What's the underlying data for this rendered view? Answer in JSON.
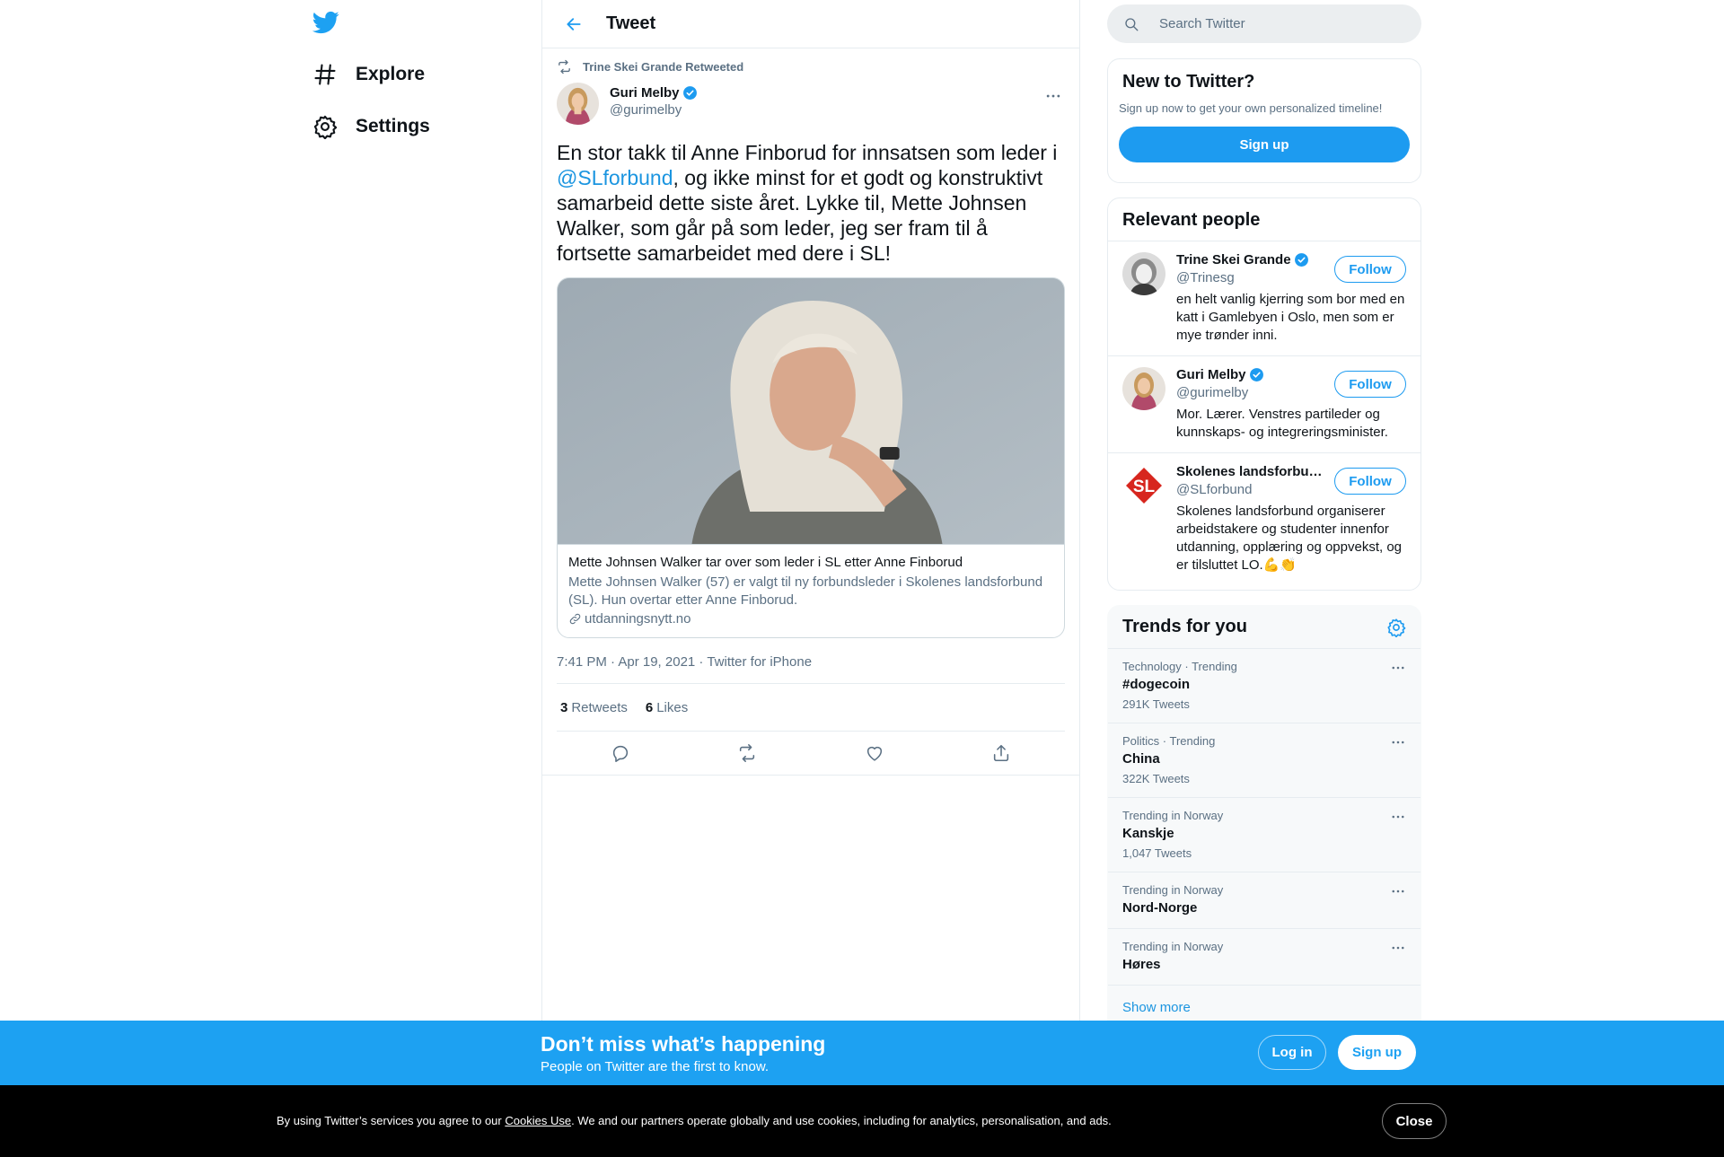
{
  "nav": {
    "logo_icon": "twitter-bird-icon",
    "items": [
      {
        "label": "Explore",
        "icon": "hashtag-icon"
      },
      {
        "label": "Settings",
        "icon": "gear-icon"
      }
    ]
  },
  "header": {
    "title": "Tweet",
    "back_icon": "back-arrow-icon"
  },
  "tweet": {
    "retweeted_by": "Trine Skei Grande Retweeted",
    "author_name": "Guri Melby",
    "author_handle": "@gurimelby",
    "text_before": "En stor takk til Anne Finborud for innsatsen som leder i ",
    "mention": "@SLforbund",
    "text_after": ", og ikke minst for et godt og konstruktivt samarbeid dette siste året. Lykke til, Mette Johnsen Walker, som går på som leder, jeg ser fram til å fortsette samarbeidet med dere i SL!",
    "card": {
      "title": "Mette Johnsen Walker tar over som leder i SL etter Anne Finborud",
      "description": "Mette Johnsen Walker (57) er valgt til ny forbundsleder i Skolenes landsforbund (SL). Hun overtar etter Anne Finborud.",
      "domain": "utdanningsnytt.no"
    },
    "meta": "7:41 PM · Apr 19, 2021 · Twitter for iPhone",
    "retweets_count": "3",
    "retweets_label": "Retweets",
    "likes_count": "6",
    "likes_label": "Likes"
  },
  "search": {
    "placeholder": "Search Twitter"
  },
  "new_to_twitter": {
    "title": "New to Twitter?",
    "subtitle": "Sign up now to get your own personalized timeline!",
    "signup_label": "Sign up"
  },
  "relevant_people": {
    "title": "Relevant people",
    "follow_label": "Follow",
    "people": [
      {
        "name": "Trine Skei Grande",
        "handle": "@Trinesg",
        "verified": true,
        "bio": "en helt vanlig kjerring som bor med en katt i Gamlebyen i Oslo, men som er mye trønder inni."
      },
      {
        "name": "Guri Melby",
        "handle": "@gurimelby",
        "verified": true,
        "bio": "Mor. Lærer. Venstres partileder og kunnskaps- og integreringsminister."
      },
      {
        "name": "Skolenes landsforbu…",
        "handle": "@SLforbund",
        "verified": false,
        "bio": "Skolenes landsforbund organiserer arbeidstakere og studenter innenfor utdanning, opplæring og oppvekst, og er tilsluttet LO.💪👏"
      }
    ]
  },
  "trends": {
    "title": "Trends for you",
    "items": [
      {
        "context": "Technology · Trending",
        "name": "#dogecoin",
        "count": "291K Tweets"
      },
      {
        "context": "Politics · Trending",
        "name": "China",
        "count": "322K Tweets"
      },
      {
        "context": "Trending in Norway",
        "name": "Kanskje",
        "count": "1,047 Tweets"
      },
      {
        "context": "Trending in Norway",
        "name": "Nord-Norge",
        "count": ""
      },
      {
        "context": "Trending in Norway",
        "name": "Høres",
        "count": ""
      }
    ],
    "show_more": "Show more"
  },
  "banner": {
    "title": "Don’t miss what’s happening",
    "subtitle": "People on Twitter are the first to know.",
    "login_label": "Log in",
    "signup_label": "Sign up"
  },
  "cookie": {
    "text_before": "By using Twitter’s services you agree to our ",
    "link": "Cookies Use",
    "text_after": ". We and our partners operate globally and use cookies, including for analytics, personalisation, and ads.",
    "close_label": "Close"
  },
  "colors": {
    "accent": "#1d9bf0",
    "banner": "#1da1f2",
    "muted": "#5b7083"
  }
}
